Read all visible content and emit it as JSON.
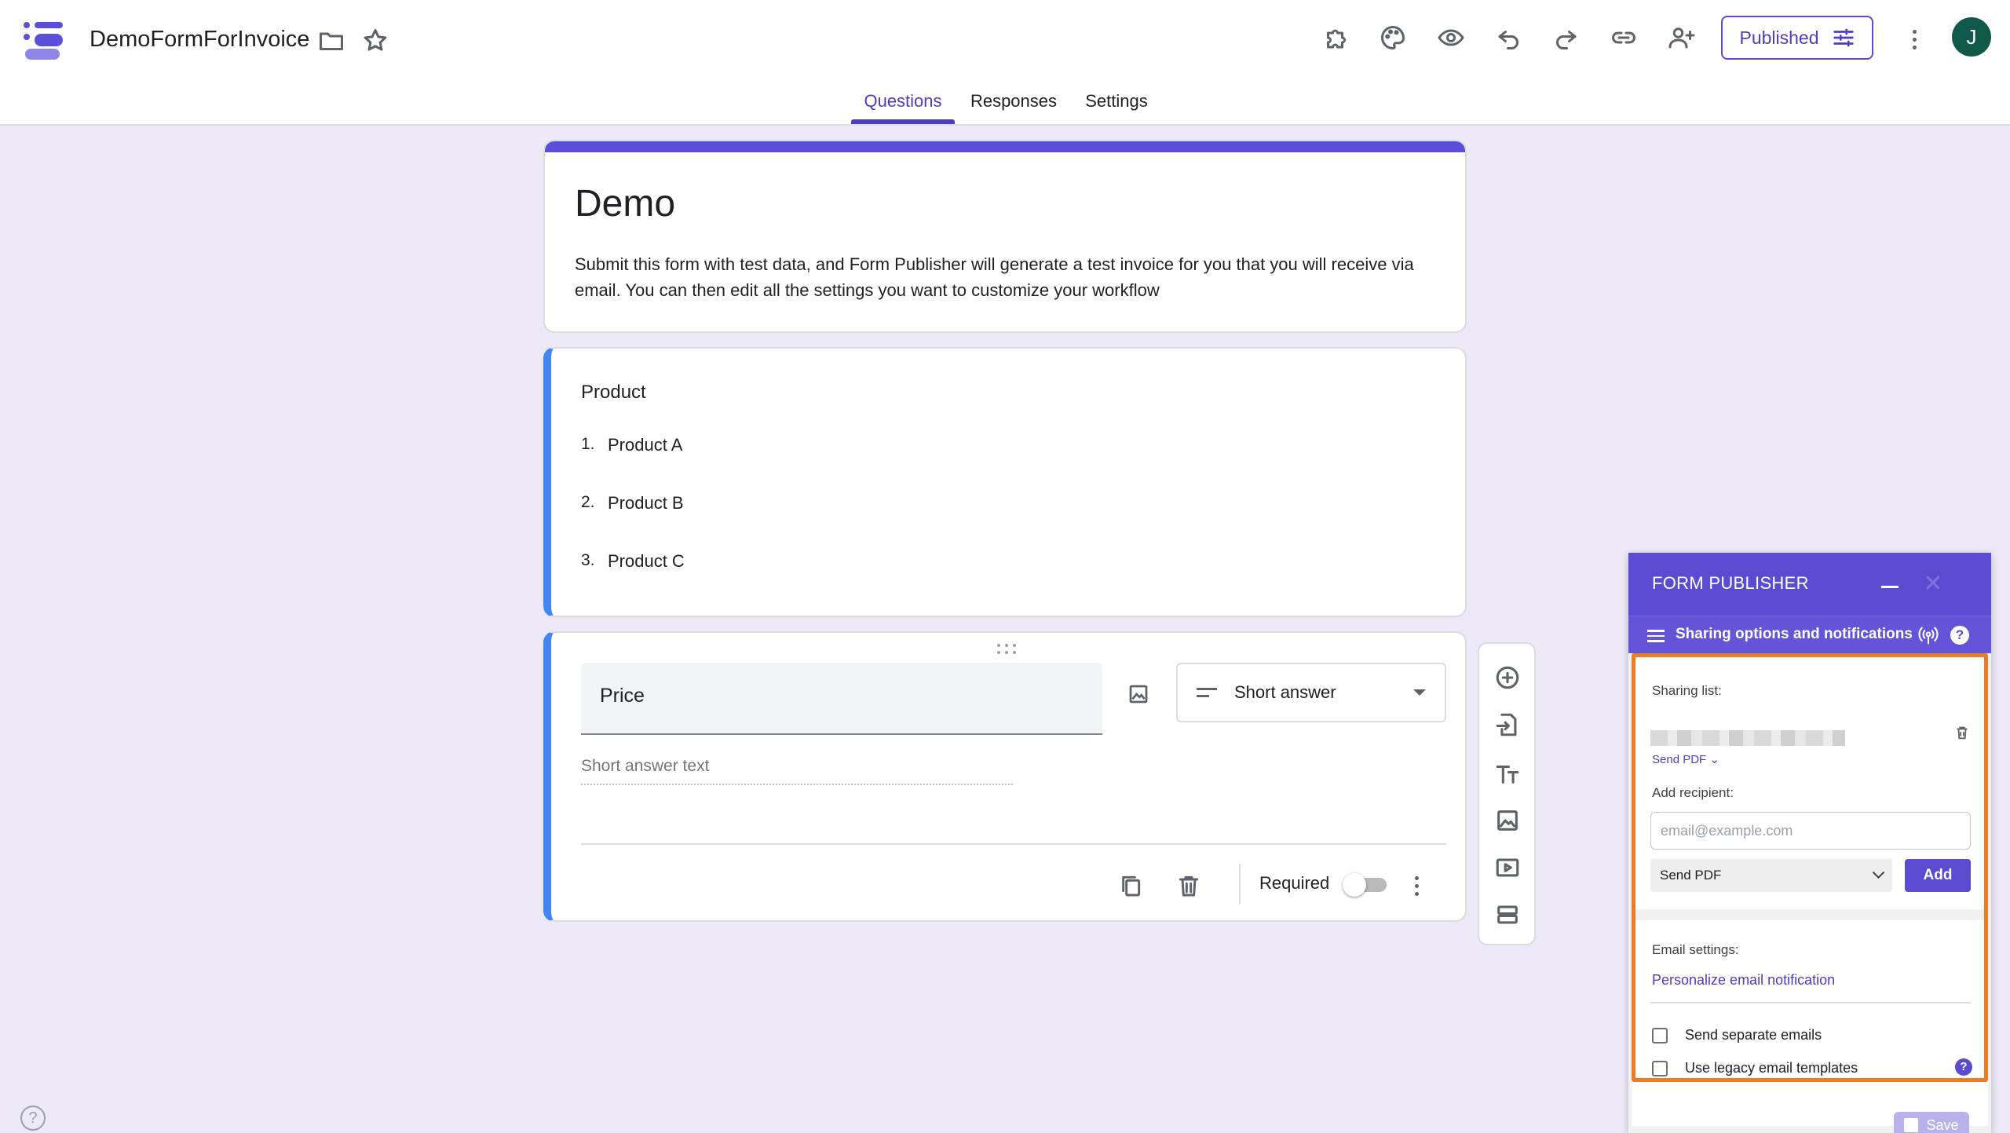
{
  "header": {
    "doc_title": "DemoFormForInvoice",
    "published_label": "Published",
    "avatar_initial": "J",
    "accent_color": "#4b3fb8",
    "icons": [
      "logo-icon",
      "folder-icon",
      "star-icon",
      "addon-puzzle-icon",
      "palette-icon",
      "preview-eye-icon",
      "undo-icon",
      "redo-icon",
      "link-icon",
      "add-collaborator-icon",
      "tune-icon",
      "more-vert-icon"
    ]
  },
  "tabs": [
    {
      "label": "Questions",
      "active": true
    },
    {
      "label": "Responses",
      "active": false
    },
    {
      "label": "Settings",
      "active": false
    }
  ],
  "form": {
    "title": "Demo",
    "description": "Submit this form with test data, and Form Publisher will generate a test invoice for you that you will receive via email. You can then edit all the settings you want to customize your workflow",
    "header_color": "#5b4fd9"
  },
  "question_product": {
    "title": "Product",
    "options": [
      {
        "num": "1.",
        "label": "Product A"
      },
      {
        "num": "2.",
        "label": "Product B"
      },
      {
        "num": "3.",
        "label": "Product C"
      }
    ]
  },
  "question_price": {
    "title": "Price",
    "type": "Short answer",
    "placeholder": "Short answer text",
    "required_label": "Required",
    "required": false
  },
  "form_publisher": {
    "title": "FORM PUBLISHER",
    "subtitle": "Sharing options and notifications",
    "sharing_list_label": "Sharing list:",
    "send_pdf_link": "Send PDF",
    "add_recipient_label": "Add recipient:",
    "email_placeholder": "email@example.com",
    "send_select_value": "Send PDF",
    "add_button": "Add",
    "email_settings_label": "Email settings:",
    "personalize_link": "Personalize email notification",
    "checkbox_separate": "Send separate emails",
    "checkbox_legacy": "Use legacy email templates",
    "save_button": "Save",
    "highlight_color": "#ed7d25",
    "brand_color": "#5a4bd1"
  }
}
